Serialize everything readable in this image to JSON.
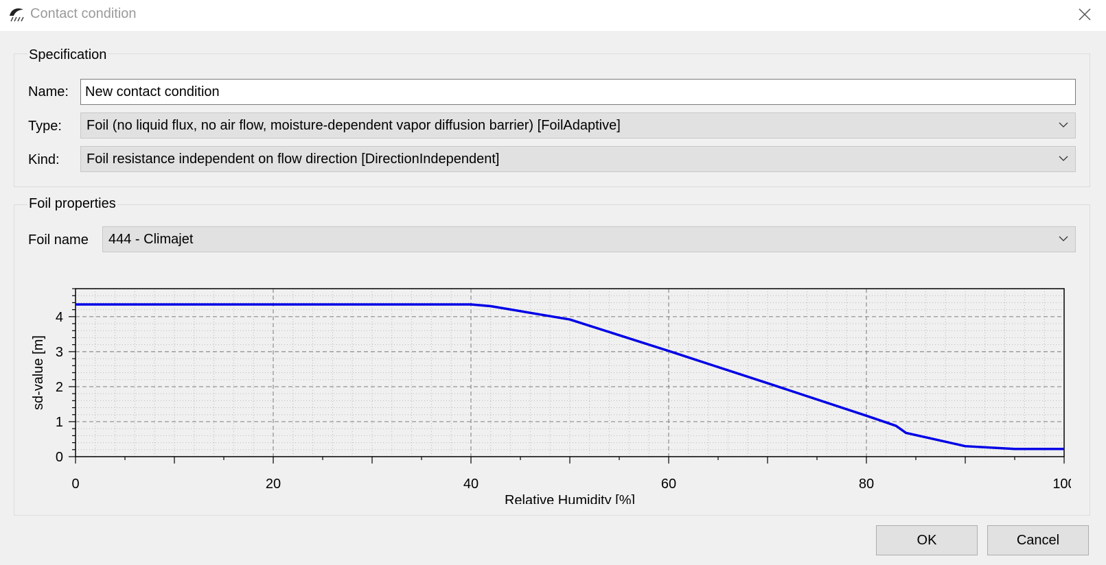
{
  "window": {
    "title": "Contact condition"
  },
  "specification": {
    "group_title": "Specification",
    "name_label": "Name:",
    "name_value": "New contact condition",
    "type_label": "Type:",
    "type_value": "Foil (no liquid flux, no air flow, moisture-dependent vapor diffusion barrier) [FoilAdaptive]",
    "kind_label": "Kind:",
    "kind_value": "Foil resistance independent on flow direction [DirectionIndependent]"
  },
  "foil": {
    "group_title": "Foil properties",
    "name_label": "Foil name",
    "name_value": "444 - Climajet"
  },
  "buttons": {
    "ok": "OK",
    "cancel": "Cancel"
  },
  "icons": {
    "app": "rain-wall-icon",
    "close": "close-icon",
    "dropdown": "chevron-down-icon"
  },
  "chart_data": {
    "type": "line",
    "xlabel": "Relative Humidity [%]",
    "ylabel": "sd-value [m]",
    "xlim": [
      0,
      100
    ],
    "ylim": [
      0,
      4.8
    ],
    "xticks": [
      0,
      20,
      40,
      60,
      80,
      100
    ],
    "yticks": [
      0,
      1,
      2,
      3,
      4
    ],
    "grid": true,
    "line_color": "#0000e6",
    "series": [
      {
        "x": [
          0,
          40,
          42,
          50,
          60,
          70,
          80,
          83,
          84,
          90,
          95,
          100
        ],
        "y": [
          4.35,
          4.35,
          4.3,
          3.92,
          3.02,
          2.1,
          1.17,
          0.88,
          0.68,
          0.3,
          0.22,
          0.22
        ]
      }
    ]
  }
}
